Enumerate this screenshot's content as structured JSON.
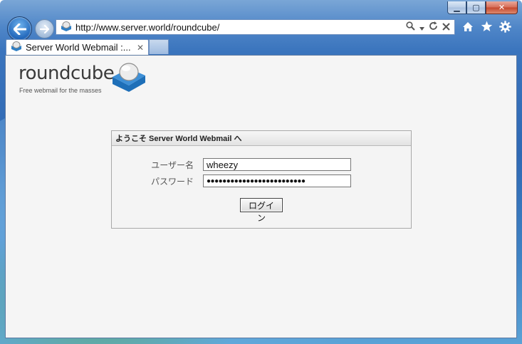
{
  "browser": {
    "url": "http://www.server.world/roundcube/",
    "tab_title": "Server World Webmail :...",
    "tab_close": "✕",
    "caption": {
      "minimize": "▁",
      "maximize": "▢",
      "close": "✕"
    }
  },
  "logo": {
    "name": "roundcube",
    "tagline": "Free webmail for the masses"
  },
  "login": {
    "heading": "ようこそ Server World Webmail へ",
    "username_label": "ユーザー名",
    "username_value": "wheezy",
    "password_label": "パスワード",
    "password_value": "●●●●●●●●●●●●●●●●●●●●●●●●●",
    "submit_label": "ログイン"
  },
  "colors": {
    "frame": "#2f69b4",
    "content_bg": "#f5f5f5",
    "logo_blue": "#2f7fc4"
  }
}
